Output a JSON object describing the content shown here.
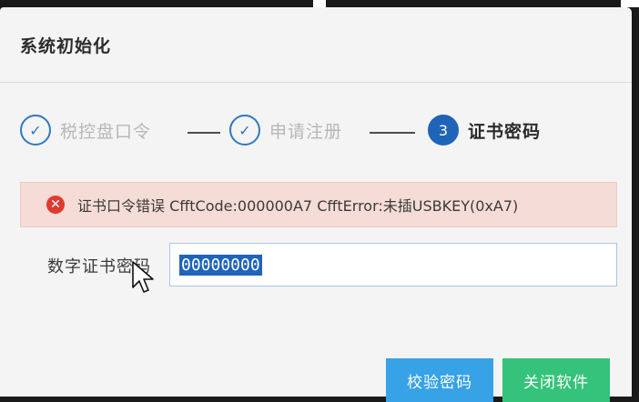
{
  "dialog": {
    "title": "系统初始化"
  },
  "steps": [
    {
      "label": "税控盘口令",
      "marker": "✓",
      "state": "done"
    },
    {
      "label": "申请注册",
      "marker": "✓",
      "state": "done"
    },
    {
      "label": "证书密码",
      "marker": "3",
      "state": "active"
    }
  ],
  "alert": {
    "icon": "error-icon",
    "message": "证书口令错误 CfftCode:000000A7 CfftError:未插USBKEY(0xA7)",
    "color": "#e03a30"
  },
  "cert_password": {
    "label": "数字证书密码",
    "value": "00000000"
  },
  "buttons": {
    "verify_label": "校验密码",
    "close_label": "关闭软件"
  },
  "colors": {
    "accent": "#1f64b8",
    "verify_button": "#37a2e6",
    "close_button": "#35c27a",
    "alert_background": "#f6dcd6"
  }
}
